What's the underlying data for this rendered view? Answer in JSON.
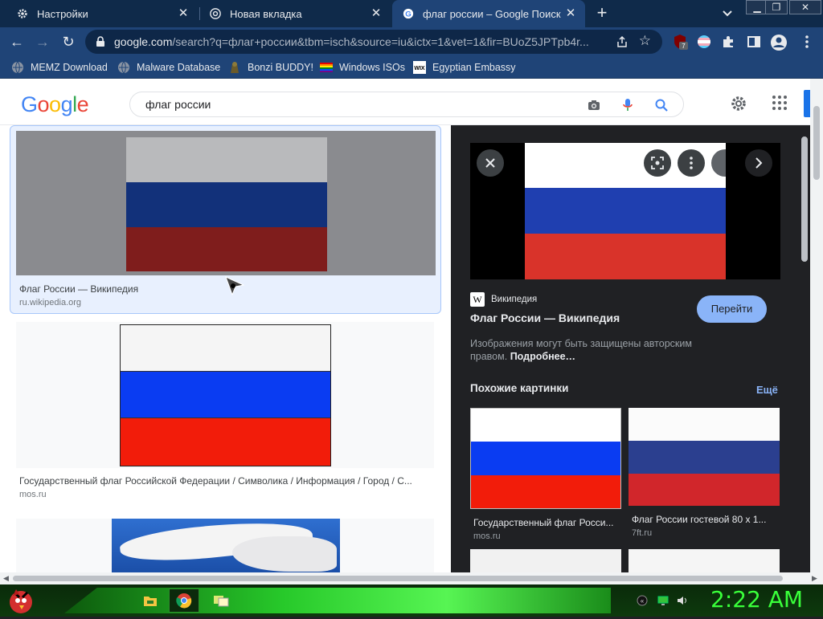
{
  "browser": {
    "tabs": [
      {
        "label": "Настройки",
        "icon": "gear-icon",
        "active": false
      },
      {
        "label": "Новая вкладка",
        "icon": "chrome-icon",
        "active": false
      },
      {
        "label": "флаг россии – Google Поиск",
        "icon": "google-g-icon",
        "active": true
      }
    ],
    "url_host": "google.com",
    "url_rest": "/search?q=флаг+россии&tbm=isch&source=iu&ictx=1&vet=1&fir=BUoZ5JPTpb4r...",
    "extension_badge": "7",
    "bookmarks": [
      {
        "label": "MEMZ Download",
        "icon": "globe-icon"
      },
      {
        "label": "Malware Database",
        "icon": "globe-icon"
      },
      {
        "label": "Bonzi BUDDY!",
        "icon": "bonzi-icon"
      },
      {
        "label": "Windows ISOs",
        "icon": "rainbow-flag-icon"
      },
      {
        "label": "Egyptian Embassy",
        "icon": "wix-icon"
      }
    ]
  },
  "google": {
    "logo": "Google",
    "query": "флаг россии"
  },
  "results": [
    {
      "title": "Флаг России — Википедия",
      "source": "ru.wikipedia.org",
      "selected": true
    },
    {
      "title": "Государственный флаг Российской Федерации / Символика / Информация / Город / С...",
      "source": "mos.ru",
      "selected": false
    },
    {
      "title": "",
      "source": "",
      "selected": false
    }
  ],
  "preview": {
    "source_icon": "W",
    "source": "Википедия",
    "title": "Флаг России — Википедия",
    "go_label": "Перейти",
    "rights_text": "Изображения могут быть защищены авторским правом.",
    "rights_more": "Подробнее…",
    "similar_heading": "Похожие картинки",
    "more_label": "Ещё",
    "similar": [
      {
        "title": "Государственный флаг Росси...",
        "source": "mos.ru"
      },
      {
        "title": "Флаг России гостевой 80 x 1...",
        "source": "7ft.ru"
      }
    ]
  },
  "colors": {
    "flag_white": "#ffffff",
    "flag_blue": "#0039a6",
    "flag_red": "#d52b1e",
    "accent": "#8ab4f8"
  },
  "taskbar": {
    "clock": "2:22 AM"
  }
}
